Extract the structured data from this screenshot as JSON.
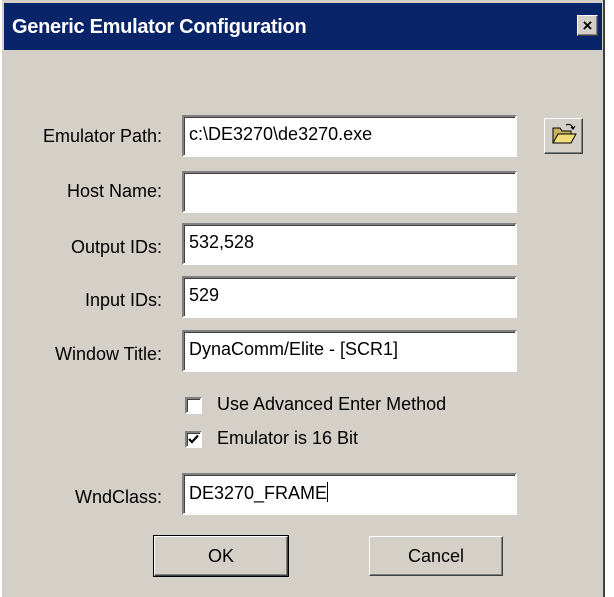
{
  "window": {
    "title": "Generic Emulator Configuration",
    "close_label": "×"
  },
  "fields": {
    "emulator_path": {
      "label": "Emulator Path:",
      "value": "c:\\DE3270\\de3270.exe"
    },
    "host_name": {
      "label": "Host Name:",
      "value": ""
    },
    "output_ids": {
      "label": "Output IDs:",
      "value": "532,528"
    },
    "input_ids": {
      "label": "Input IDs:",
      "value": "529"
    },
    "window_title": {
      "label": "Window Title:",
      "value": "DynaComm/Elite - [SCR1]"
    },
    "wnd_class": {
      "label": "WndClass:",
      "value": "DE3270_FRAME"
    }
  },
  "checkboxes": {
    "advanced_enter": {
      "label": "Use Advanced Enter Method",
      "checked": false
    },
    "sixteen_bit": {
      "label": "Emulator is 16 Bit",
      "checked": true
    }
  },
  "buttons": {
    "ok": "OK",
    "cancel": "Cancel"
  },
  "icons": {
    "browse": "open-folder-icon",
    "close": "close-icon",
    "check": "checkmark-icon"
  },
  "colors": {
    "title_bar": "#0a246a",
    "dialog_face": "#d4d0c8",
    "field_bg": "#ffffff"
  }
}
